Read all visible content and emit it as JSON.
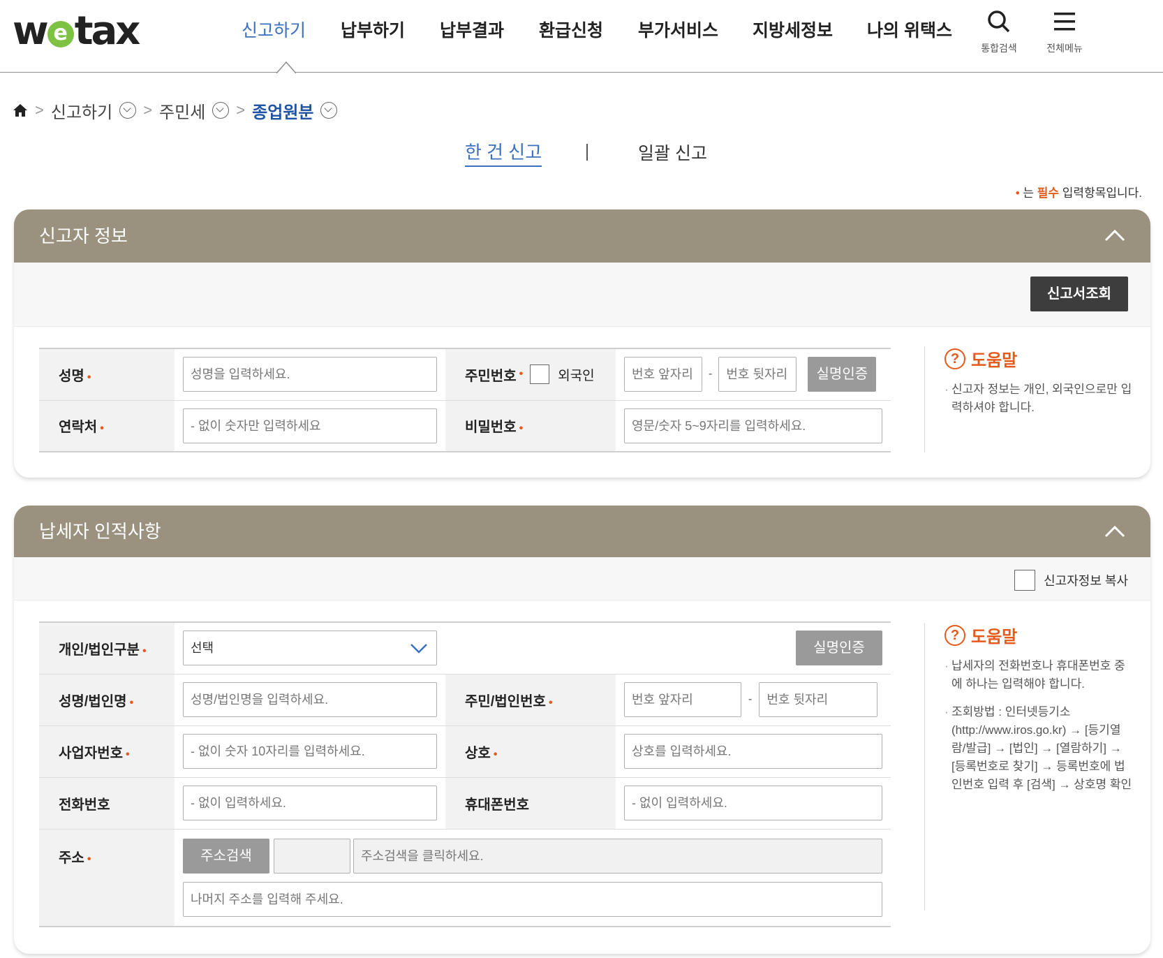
{
  "brand": {
    "pre": "w",
    "e": "e",
    "post": "tax"
  },
  "nav": {
    "items": [
      "신고하기",
      "납부하기",
      "납부결과",
      "환급신청",
      "부가서비스",
      "지방세정보",
      "나의 위택스"
    ],
    "search_label": "통합검색",
    "menu_label": "전체메뉴"
  },
  "breadcrumb": {
    "level1": "신고하기",
    "level2": "주민세",
    "level3": "종업원분"
  },
  "tabs": {
    "single": "한 건 신고",
    "bulk": "일괄 신고"
  },
  "required_note": {
    "dot": "•",
    "pre": " 는 ",
    "bold": "필수",
    "post": " 입력항목입니다."
  },
  "section1": {
    "title": "신고자 정보",
    "lookup_button": "신고서조회",
    "name_label": "성명",
    "name_placeholder": "성명을 입력하세요.",
    "rrn_label": "주민번호",
    "foreigner_label": "외국인",
    "rrn_front_placeholder": "번호 앞자리",
    "rrn_back_placeholder": "번호 뒷자리",
    "dash": "-",
    "verify_button": "실명인증",
    "contact_label": "연락처",
    "contact_placeholder": "- 없이 숫자만 입력하세요",
    "password_label": "비밀번호",
    "password_placeholder": "영문/숫자 5~9자리를 입력하세요.",
    "help_title": "도움말",
    "help_text": "신고자 정보는 개인, 외국인으로만 입력하셔야 합니다."
  },
  "section2": {
    "title": "납세자 인적사항",
    "copy_label": "신고자정보 복사",
    "type_label": "개인/법인구분",
    "type_value": "선택",
    "verify_button": "실명인증",
    "name_label": "성명/법인명",
    "name_placeholder": "성명/법인명을 입력하세요.",
    "id_label": "주민/법인번호",
    "id_front_placeholder": "번호 앞자리",
    "id_back_placeholder": "번호 뒷자리",
    "dash": "-",
    "biz_label": "사업자번호",
    "biz_placeholder": "- 없이 숫자 10자리를 입력하세요.",
    "trade_label": "상호",
    "trade_placeholder": "상호를 입력하세요.",
    "phone_label": "전화번호",
    "phone_placeholder": "- 없이 입력하세요.",
    "mobile_label": "휴대폰번호",
    "mobile_placeholder": "- 없이 입력하세요.",
    "addr_label": "주소",
    "addr_search_button": "주소검색",
    "addr_search_placeholder": "주소검색을 클릭하세요.",
    "addr_detail_placeholder": "나머지 주소를 입력해 주세요.",
    "help_title": "도움말",
    "help_text1": "납세자의 전화번호나 휴대폰번호 중에 하나는 입력해야 합니다.",
    "help_text2": "조회방법 : 인터넷등기소(http://www.iros.go.kr) → [등기열람/발급] → [법인] → [열람하기] → [등록번호로 찾기] → 등록번호에 법인번호 입력 후 [검색] → 상호명 확인"
  },
  "colors": {
    "accent": "#3a6fc2",
    "section_header": "#9b917f",
    "required": "#e55a1c",
    "logo_e": "#7dc243"
  },
  "icons": [
    "home-icon",
    "search-icon",
    "hamburger-icon",
    "chevron-up-icon",
    "chevron-down-icon",
    "help-icon"
  ]
}
